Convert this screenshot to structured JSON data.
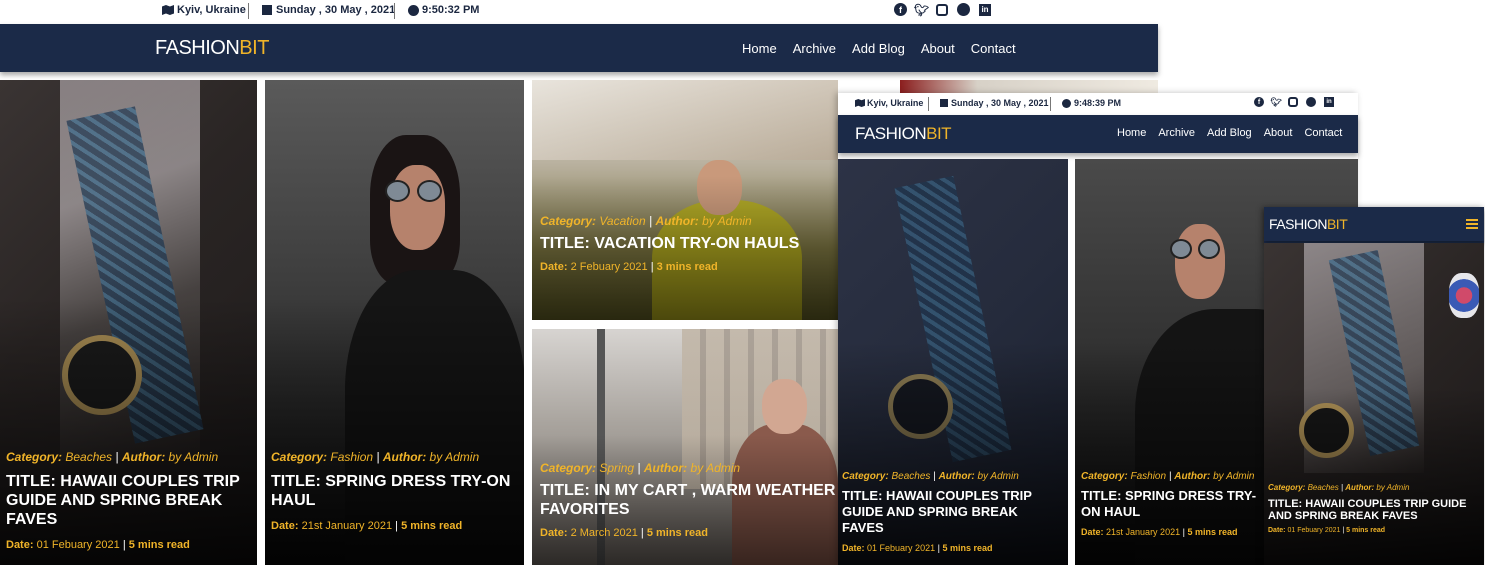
{
  "topbar": {
    "location": "Kyiv, Ukraine",
    "date": "Sunday , 30 May , 2021",
    "time_desktop": "9:50:32 PM",
    "time_tablet": "9:48:39 PM",
    "socials": [
      "facebook-icon",
      "twitter-icon",
      "instagram-icon",
      "snapchat-icon",
      "linkedin-icon"
    ]
  },
  "brand": {
    "part1": "FASHION",
    "part2": "BIT"
  },
  "nav": [
    "Home",
    "Archive",
    "Add Blog",
    "About",
    "Contact"
  ],
  "labels": {
    "category": "Category:",
    "author": "Author:",
    "date": "Date:",
    "sep": "|"
  },
  "posts": [
    {
      "category": "Beaches",
      "author": "by Admin",
      "title": "TITLE: HAWAII COUPLES TRIP GUIDE AND SPRING BREAK FAVES",
      "date": "01 Febuary 2021",
      "read": "5 mins read"
    },
    {
      "category": "Fashion",
      "author": "by Admin",
      "title": "TITLE: SPRING DRESS TRY-ON HAUL",
      "date": "21st January 2021",
      "read": "5 mins read"
    },
    {
      "category": "Vacation",
      "author": "by Admin",
      "title": "TITLE: VACATION TRY-ON HAULS",
      "date": "2 Febuary 2021",
      "read": "3 mins read"
    },
    {
      "category": "Spring",
      "author": "by Admin",
      "title": "TITLE: IN MY CART , WARM WEATHER FAVORITES",
      "date": "2 March 2021",
      "read": "5 mins read"
    }
  ],
  "colors": {
    "navy": "#1b2a48",
    "accent": "#f0b429"
  }
}
